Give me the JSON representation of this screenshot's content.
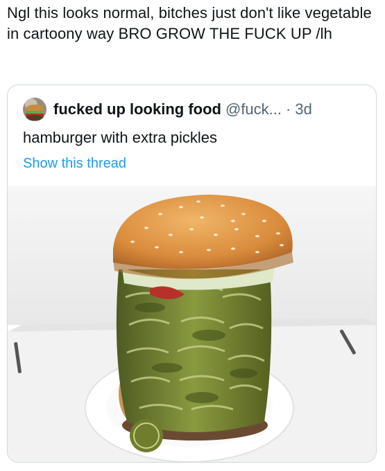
{
  "tweet": {
    "text": "Ngl this looks normal, bitches just don't like vegetable in cartoony way BRO GROW THE FUCK UP /lh"
  },
  "quoted_tweet": {
    "display_name": "fucked up looking food",
    "handle": "@fuck...",
    "separator": "·",
    "time": "3d",
    "text": "hamburger with extra pickles",
    "show_thread_label": "Show this thread",
    "link_color": "#1d9bf0"
  },
  "photo": {
    "subject": "burger-tall-pickle-stack"
  }
}
